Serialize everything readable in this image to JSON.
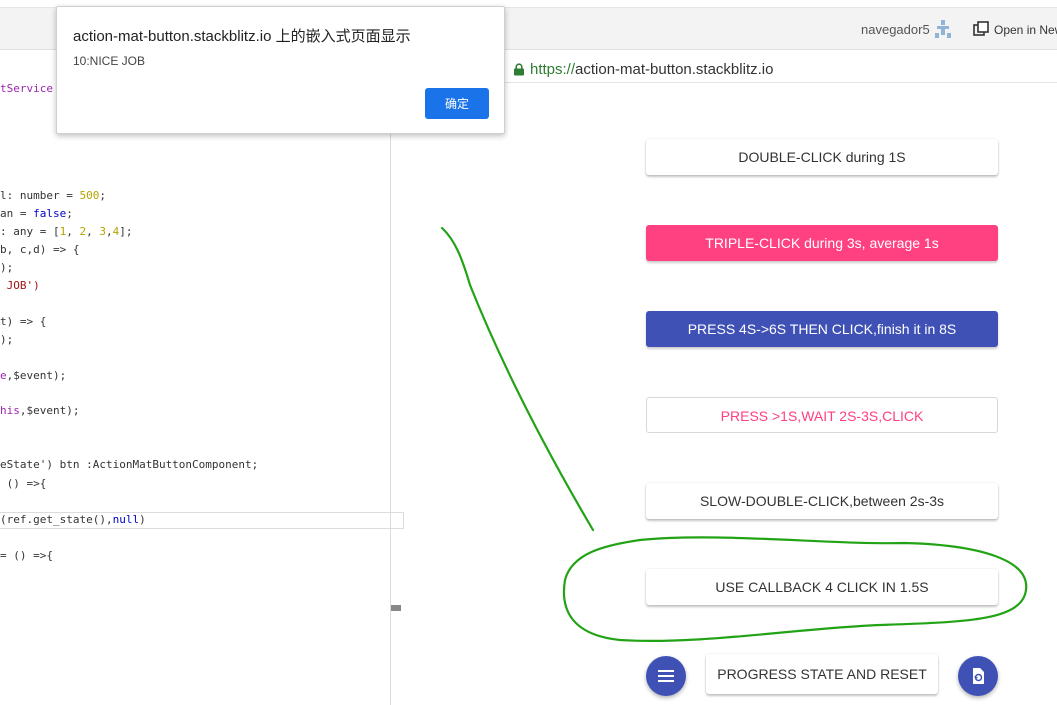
{
  "toolbar": {
    "user_name": "navegador5",
    "open_new_label": "Open in New"
  },
  "dialog": {
    "title": "action-mat-button.stackblitz.io 上的嵌入式页面显示",
    "message": "10:NICE JOB",
    "ok_label": "确定"
  },
  "url_bar": {
    "scheme": "https://",
    "host": "action-mat-button.stackblitz.io"
  },
  "code": {
    "line_service": "tService",
    "line_1": "l: number = ",
    "line_1_num": "500",
    "line_2": "an = ",
    "line_2_kw": "false",
    "line_3": ": any = [",
    "line_3_a": "1",
    "line_3_b": "2",
    "line_3_c": "3",
    "line_3_d": "4",
    "line_4": "b, c,d) => {",
    "line_5": ");",
    "line_6": " JOB')",
    "line_7": "t) => {",
    "line_8": ");",
    "line_9a": "e",
    "line_9b": ",$event);",
    "line_10a": "his",
    "line_10b": ",$event);",
    "line_11": "eState') btn :ActionMatButtonComponent;",
    "line_12": " () =>{",
    "line_13a": "(ref.get_state(),",
    "line_13b": "null",
    "line_13c": ")",
    "line_14": "= () =>{"
  },
  "preview": {
    "buttons": [
      "DOUBLE-CLICK during 1S",
      "TRIPLE-CLICK during 3s, average 1s",
      "PRESS 4S->6S THEN CLICK,finish it in 8S",
      "PRESS >1S,WAIT 2S-3S,CLICK",
      "SLOW-DOUBLE-CLICK,between 2s-3s",
      "USE CALLBACK 4 CLICK IN 1.5S"
    ],
    "progress_label": "PROGRESS STATE AND RESET"
  },
  "colors": {
    "accent": "#ff4081",
    "primary": "#3f51b5",
    "dialog_button": "#1a73e8",
    "annotation": "#22a316"
  }
}
